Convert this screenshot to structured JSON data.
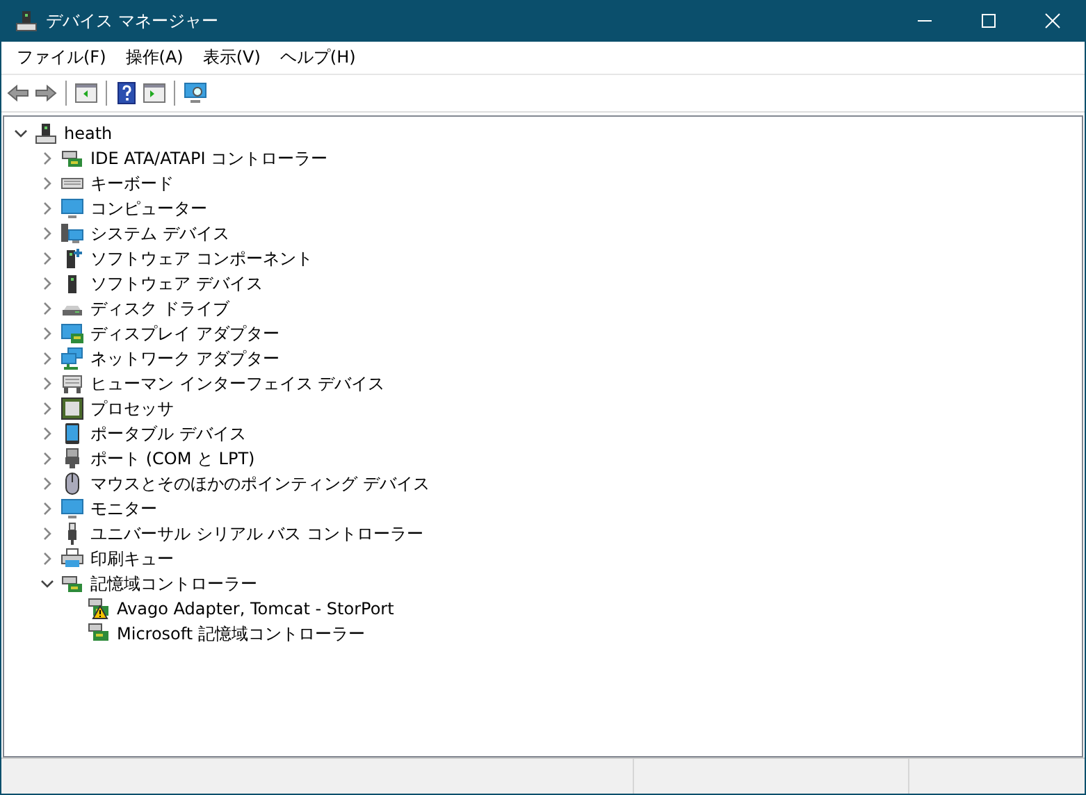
{
  "window": {
    "title": "デバイス マネージャー"
  },
  "menu": [
    "ファイル(F)",
    "操作(A)",
    "表示(V)",
    "ヘルプ(H)"
  ],
  "tree": {
    "label": "heath",
    "expanded": true,
    "children": [
      {
        "label": "IDE ATA/ATAPI コントローラー",
        "expanded": false
      },
      {
        "label": "キーボード",
        "expanded": false
      },
      {
        "label": "コンピューター",
        "expanded": false
      },
      {
        "label": "システム デバイス",
        "expanded": false
      },
      {
        "label": "ソフトウェア コンポーネント",
        "expanded": false
      },
      {
        "label": "ソフトウェア デバイス",
        "expanded": false
      },
      {
        "label": "ディスク ドライブ",
        "expanded": false
      },
      {
        "label": "ディスプレイ アダプター",
        "expanded": false
      },
      {
        "label": "ネットワーク アダプター",
        "expanded": false
      },
      {
        "label": "ヒューマン インターフェイス デバイス",
        "expanded": false
      },
      {
        "label": "プロセッサ",
        "expanded": false
      },
      {
        "label": "ポータブル デバイス",
        "expanded": false
      },
      {
        "label": "ポート (COM と LPT)",
        "expanded": false
      },
      {
        "label": "マウスとそのほかのポインティング デバイス",
        "expanded": false
      },
      {
        "label": "モニター",
        "expanded": false
      },
      {
        "label": "ユニバーサル シリアル バス コントローラー",
        "expanded": false
      },
      {
        "label": "印刷キュー",
        "expanded": false
      },
      {
        "label": "記憶域コントローラー",
        "expanded": true,
        "children": [
          {
            "label": "Avago Adapter, Tomcat - StorPort",
            "warning": true
          },
          {
            "label": "Microsoft 記憶域コントローラー",
            "warning": false
          }
        ]
      }
    ]
  }
}
